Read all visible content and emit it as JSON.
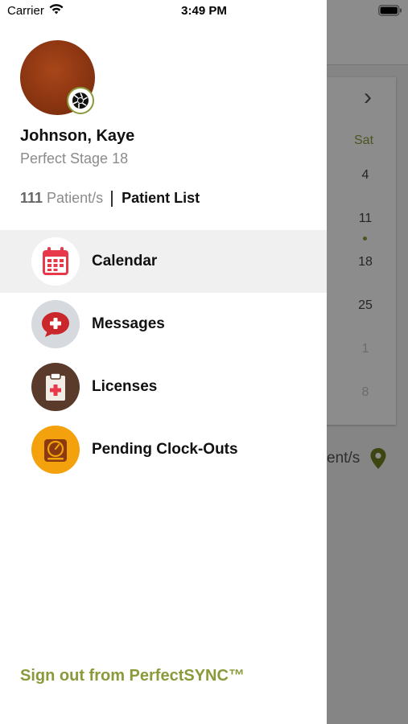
{
  "status_bar": {
    "carrier": "Carrier",
    "time": "3:49 PM"
  },
  "background": {
    "weekday_label": "Sat",
    "days": [
      "4",
      "11",
      "18",
      "25",
      "1",
      "8"
    ],
    "footer_partial": "ent/s"
  },
  "profile": {
    "name": "Johnson, Kaye",
    "subtitle": "Perfect Stage 18",
    "patient_count": "111",
    "patient_count_suffix": "Patient/s",
    "patient_list_label": "Patient List"
  },
  "menu": {
    "items": [
      {
        "label": "Calendar",
        "icon": "calendar-icon",
        "selected": true
      },
      {
        "label": "Messages",
        "icon": "messages-icon",
        "selected": false
      },
      {
        "label": "Licenses",
        "icon": "licenses-icon",
        "selected": false
      },
      {
        "label": "Pending Clock-Outs",
        "icon": "clock-out-icon",
        "selected": false
      }
    ]
  },
  "sign_out_label": "Sign out from PerfectSYNC™",
  "colors": {
    "accent": "#8a9a3a",
    "calendar_red": "#e8394a",
    "messages_red": "#c9272b",
    "licenses_brown": "#5a3a2a",
    "clockout_orange": "#f3a10c"
  }
}
